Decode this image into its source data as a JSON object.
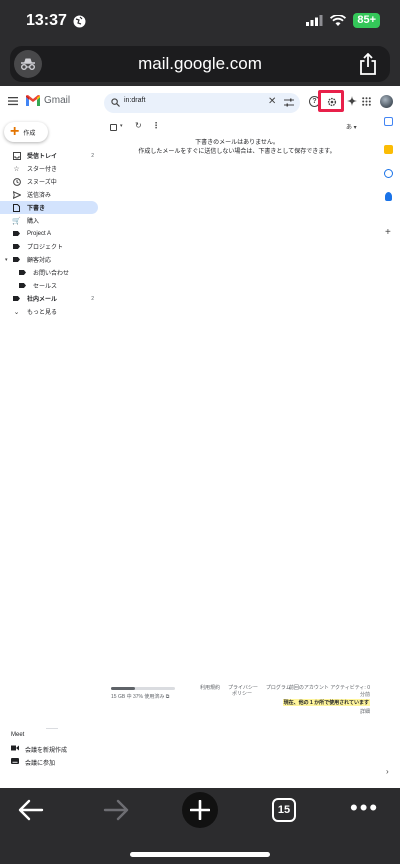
{
  "status_bar": {
    "time": "13:37",
    "battery": "85+"
  },
  "browser": {
    "url": "mail.google.com",
    "tab_count": "15"
  },
  "gmail": {
    "brand": "Gmail",
    "search_value": "in:draft",
    "compose_label": "作成",
    "nav": [
      {
        "label": "受信トレイ",
        "count": "2",
        "bold": true
      },
      {
        "label": "スター付き"
      },
      {
        "label": "スヌーズ中"
      },
      {
        "label": "送信済み"
      },
      {
        "label": "下書き",
        "active": true
      },
      {
        "label": "購入"
      },
      {
        "label": "Project A"
      },
      {
        "label": "プロジェクト"
      },
      {
        "label": "顧客対応"
      },
      {
        "label": "お問い合わせ"
      },
      {
        "label": "セールス"
      },
      {
        "label": "社内メール",
        "count": "2",
        "bold": true
      },
      {
        "label": "もっと見る"
      }
    ],
    "toolbar": {
      "lang_button": "あ"
    },
    "empty_message": {
      "line1": "下書きのメールはありません。",
      "line2": "作成したメールをすぐに送信しない場合は、下書きとして保存できます。"
    },
    "footer": {
      "storage_used_fraction": 0.37,
      "storage_text": "15 GB 中 37% 使用済み",
      "links": [
        "利用規約",
        "プライバシー",
        "プログラム"
      ],
      "links_sub": "ポリシー",
      "last_activity": "前回のアカウント アクティビティ: 0",
      "last_activity_2": "分前",
      "in_use": "現在、他の 1 か所で使用されています",
      "details": "詳細"
    },
    "meet": {
      "title": "Meet",
      "new_meeting": "会議を新規作成",
      "join_meeting": "会議に参加"
    }
  },
  "colors": {
    "settings_highlight": "#e8204a",
    "active_nav_bg": "#d3e3fd",
    "search_bg": "#eaf1fb",
    "battery": "#34c759"
  }
}
